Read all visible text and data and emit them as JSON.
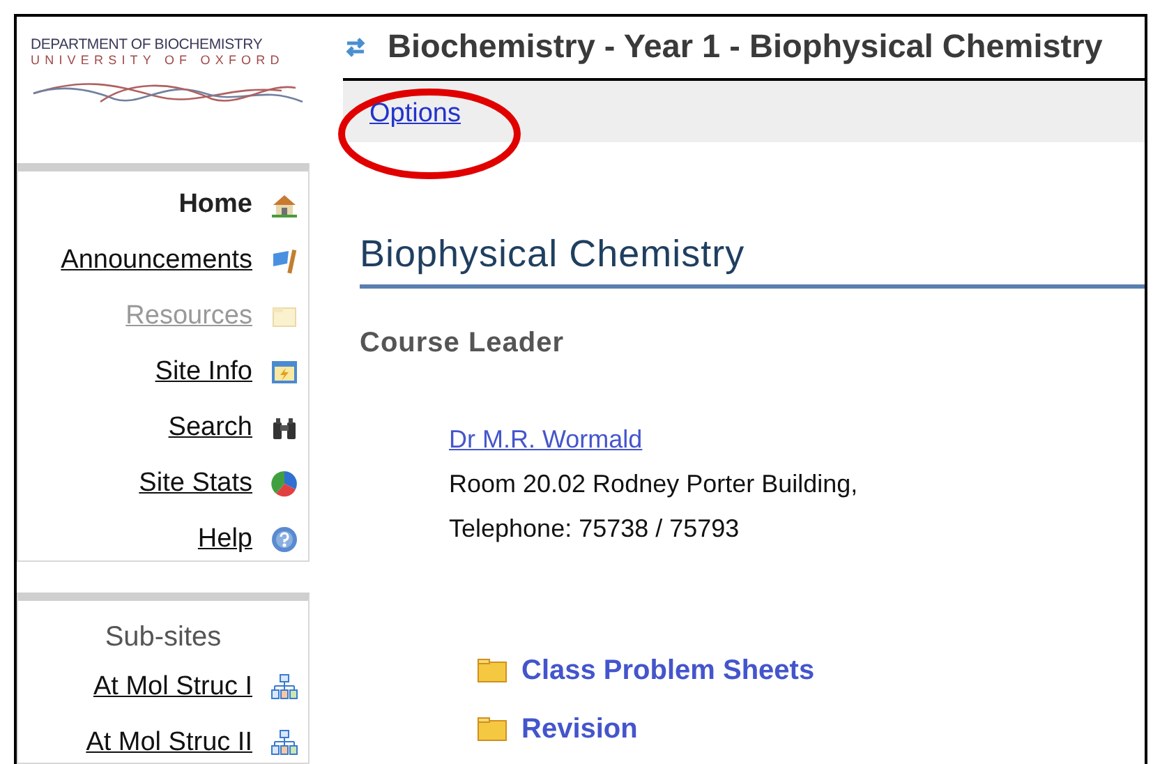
{
  "logo": {
    "line_1": "DEPARTMENT OF BIOCHEMISTRY",
    "line_2": "UNIVERSITY OF OXFORD"
  },
  "header": {
    "title": "Biochemistry - Year 1 - Biophysical Chemistry"
  },
  "toolbar": {
    "link": "Options"
  },
  "nav": [
    {
      "label": "Home",
      "kind": "current"
    },
    {
      "label": "Announcements",
      "kind": "link"
    },
    {
      "label": "Resources",
      "kind": "disabled"
    },
    {
      "label": "Site Info",
      "kind": "link"
    },
    {
      "label": "Search",
      "kind": "link"
    },
    {
      "label": "Site Stats",
      "kind": "link"
    },
    {
      "label": "Help",
      "kind": "link"
    }
  ],
  "subsites": {
    "title": "Sub-sites",
    "items": [
      "At Mol Struc I",
      "At Mol Struc II"
    ]
  },
  "content": {
    "heading": "Biophysical Chemistry",
    "subheading": "Course Leader",
    "leader_link": "Dr M.R. Wormald",
    "address": "Room 20.02 Rodney Porter Building,",
    "phone": "Telephone: 75738 / 75793",
    "folders": [
      "Class Problem Sheets",
      "Revision"
    ]
  }
}
